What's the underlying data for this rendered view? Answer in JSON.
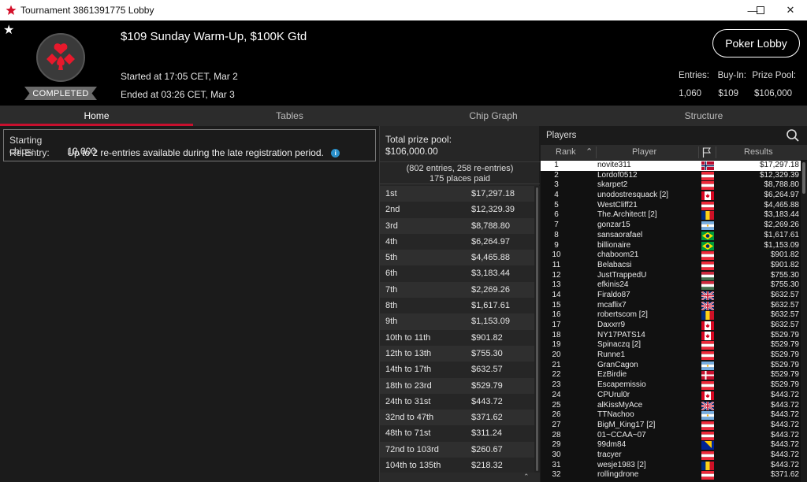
{
  "window": {
    "title": "Tournament 3861391775 Lobby",
    "controls": [
      "—",
      "☐",
      "✕"
    ]
  },
  "header": {
    "star": "★",
    "status_badge": "COMPLETED",
    "tournament_name": "$109 Sunday Warm-Up, $100K Gtd",
    "started": "Started at 17:05 CET, Mar 2",
    "ended": "Ended at 03:26 CET, Mar 3",
    "lobby_button": "Poker Lobby",
    "stats": {
      "entries_label": "Entries:",
      "entries_value": "1,060",
      "buyin_label": "Buy-In:",
      "buyin_value": "$109",
      "prizepool_label": "Prize Pool:",
      "prizepool_value": "$106,000"
    }
  },
  "tabs": [
    "Home",
    "Tables",
    "Chip Graph",
    "Structure"
  ],
  "info": {
    "starting_chips_label": "Starting chips:",
    "starting_chips_value": "10,000",
    "reentry_label": "Re-Entry:",
    "reentry_value": "Up to 2 re-entries available during the late registration period."
  },
  "prize": {
    "total_label": "Total prize pool:",
    "total_value": "$106,000.00",
    "entries_note": "(802 entries, 258 re-entries)",
    "places_paid": "175 places paid",
    "payouts": [
      [
        "1st",
        "$17,297.18"
      ],
      [
        "2nd",
        "$12,329.39"
      ],
      [
        "3rd",
        "$8,788.80"
      ],
      [
        "4th",
        "$6,264.97"
      ],
      [
        "5th",
        "$4,465.88"
      ],
      [
        "6th",
        "$3,183.44"
      ],
      [
        "7th",
        "$2,269.26"
      ],
      [
        "8th",
        "$1,617.61"
      ],
      [
        "9th",
        "$1,153.09"
      ],
      [
        "10th to 11th",
        "$901.82"
      ],
      [
        "12th to 13th",
        "$755.30"
      ],
      [
        "14th to 17th",
        "$632.57"
      ],
      [
        "18th to 23rd",
        "$529.79"
      ],
      [
        "24th to 31st",
        "$443.72"
      ],
      [
        "32nd to 47th",
        "$371.62"
      ],
      [
        "48th to 71st",
        "$311.24"
      ],
      [
        "72nd to 103rd",
        "$260.67"
      ],
      [
        "104th to 135th",
        "$218.32"
      ]
    ]
  },
  "players": {
    "title": "Players",
    "col_rank": "Rank",
    "col_player": "Player",
    "col_results": "Results",
    "rows": [
      [
        "1",
        "novite311",
        "$17,297.18",
        "no"
      ],
      [
        "2",
        "Lordof0512",
        "$12,329.39",
        "at"
      ],
      [
        "3",
        "skarpet2",
        "$8,788.80",
        "at"
      ],
      [
        "4",
        "unodostresquack [2]",
        "$6,264.97",
        "ca"
      ],
      [
        "5",
        "WestCliff21",
        "$4,465.88",
        "at"
      ],
      [
        "6",
        "The.Architectt [2]",
        "$3,183.44",
        "ro"
      ],
      [
        "7",
        "gonzar15",
        "$2,269.26",
        "ar"
      ],
      [
        "8",
        "sansaorafael",
        "$1,617.61",
        "br"
      ],
      [
        "9",
        "billionaire",
        "$1,153.09",
        "br"
      ],
      [
        "10",
        "chaboom21",
        "$901.82",
        "at"
      ],
      [
        "11",
        "Belabacsi",
        "$901.82",
        "at"
      ],
      [
        "12",
        "JustTrappedU",
        "$755.30",
        "hu"
      ],
      [
        "13",
        "efkinis24",
        "$755.30",
        "hu"
      ],
      [
        "14",
        "Firaldo87",
        "$632.57",
        "gb"
      ],
      [
        "15",
        "mcaflix7",
        "$632.57",
        "gb"
      ],
      [
        "16",
        "robertscom [2]",
        "$632.57",
        "ro"
      ],
      [
        "17",
        "Daxxrr9",
        "$632.57",
        "ca"
      ],
      [
        "18",
        "NY17PATS14",
        "$529.79",
        "ca"
      ],
      [
        "19",
        "Spinaczq [2]",
        "$529.79",
        "at"
      ],
      [
        "20",
        "Runne1",
        "$529.79",
        "at"
      ],
      [
        "21",
        "GranCagon",
        "$529.79",
        "ar"
      ],
      [
        "22",
        "EzBirdie",
        "$529.79",
        "dk"
      ],
      [
        "23",
        "Escapemissio",
        "$529.79",
        "at"
      ],
      [
        "24",
        "CPUrul0r",
        "$443.72",
        "ca"
      ],
      [
        "25",
        "alKissMyAce",
        "$443.72",
        "gb"
      ],
      [
        "26",
        "TTNachoo",
        "$443.72",
        "ar"
      ],
      [
        "27",
        "BigM_King17 [2]",
        "$443.72",
        "at"
      ],
      [
        "28",
        "01~CCAA~07",
        "$443.72",
        "at"
      ],
      [
        "29",
        "99dm84",
        "$443.72",
        "ba"
      ],
      [
        "30",
        "tracyer",
        "$443.72",
        "at"
      ],
      [
        "31",
        "wesje1983 [2]",
        "$443.72",
        "ro"
      ],
      [
        "32",
        "rollingdrone",
        "$371.62",
        "at"
      ]
    ]
  },
  "colors": {
    "accent": "#c8102e",
    "header_bg": "#000000",
    "panel_bg": "#262626"
  }
}
